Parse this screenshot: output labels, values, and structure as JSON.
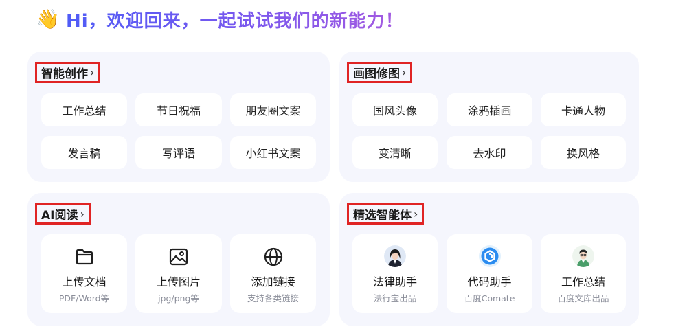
{
  "greeting": {
    "emoji": "👋",
    "text": "Hi，欢迎回来，一起试试我们的新能力！"
  },
  "panels": {
    "smart_create": {
      "title": "智能创作",
      "items": [
        "工作总结",
        "节日祝福",
        "朋友圈文案",
        "发言稿",
        "写评语",
        "小红书文案"
      ]
    },
    "draw": {
      "title": "画图修图",
      "items": [
        "国风头像",
        "涂鸦插画",
        "卡通人物",
        "变清晰",
        "去水印",
        "换风格"
      ]
    },
    "ai_read": {
      "title": "AI阅读",
      "cards": [
        {
          "label": "上传文档",
          "sub": "PDF/Word等",
          "icon": "folder-icon"
        },
        {
          "label": "上传图片",
          "sub": "jpg/png等",
          "icon": "image-icon"
        },
        {
          "label": "添加链接",
          "sub": "支持各类链接",
          "icon": "globe-icon"
        }
      ]
    },
    "agents": {
      "title": "精选智能体",
      "cards": [
        {
          "label": "法律助手",
          "sub": "法行宝出品",
          "icon": "lawyer-avatar"
        },
        {
          "label": "代码助手",
          "sub": "百度Comate",
          "icon": "comate-logo-icon"
        },
        {
          "label": "工作总结",
          "sub": "百度文库出品",
          "icon": "office-worker-avatar"
        }
      ]
    }
  },
  "chevron": "›"
}
